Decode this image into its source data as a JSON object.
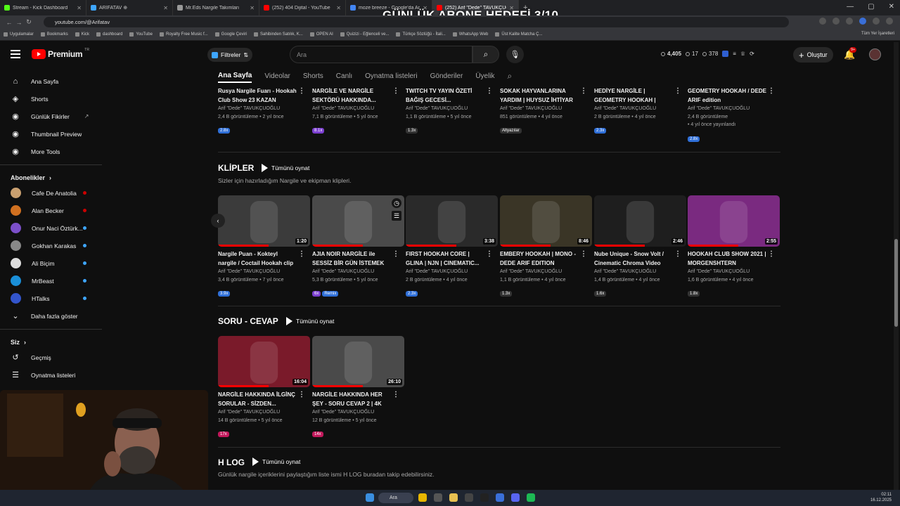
{
  "browser": {
    "tabs": [
      {
        "label": "Stream - Kick Dashboard",
        "color": "#53fc18"
      },
      {
        "label": "ARİFATAV ⊕",
        "color": "#3ea6ff"
      },
      {
        "label": "Mr.Eds Nargile Takımları",
        "color": "#999999"
      },
      {
        "label": "(252) 404 Dijital - YouTube",
        "color": "#ff0000"
      },
      {
        "label": "moze breeze - Google'da Ara",
        "color": "#4285f4"
      },
      {
        "label": "(252) Arif \"Dede\" TAVUKÇUOĞ",
        "color": "#ff0000"
      }
    ],
    "url": "youtube.com/@Arifatav",
    "bookmarks": [
      "Uygulamalar",
      "Bookmarks",
      "Kick",
      "dashboard",
      "YouTube",
      "Royalty Free Music f...",
      "Google Çeviri",
      "Sahibinden Satılık, K...",
      "OPEN AI",
      "Quizizi - Eğlenceli ve...",
      "Türkçe Sözlüğü - İtali...",
      "WhatsApp Web",
      "Üst Kalite Matcha Ç..."
    ],
    "all_bookmarks": "Tüm Yer İşaretleri"
  },
  "overlay_title": "GÜNLÜK ABONE HEDEFİ 3/10",
  "header": {
    "logo_text": "Premium",
    "logo_sup": "TR",
    "filters_label": "Filtreler",
    "search_placeholder": "Ara",
    "stats": [
      "4,405",
      "17",
      "378"
    ],
    "create_label": "Oluştur",
    "notif_badge": "9+"
  },
  "sidebar": {
    "nav": [
      {
        "label": "Ana Sayfa",
        "icon": "home-icon"
      },
      {
        "label": "Shorts",
        "icon": "shorts-icon"
      },
      {
        "label": "Günlük Fikirler",
        "icon": "bulb-icon"
      },
      {
        "label": "Thumbnail Preview",
        "icon": "image-icon"
      },
      {
        "label": "More Tools",
        "icon": "tools-icon"
      }
    ],
    "subs_title": "Abonelikler",
    "subs": [
      {
        "label": "Cafe De Anatolia",
        "color": "#c9a070",
        "live": "#cc0000"
      },
      {
        "label": "Alan Becker",
        "color": "#d07020",
        "live": "#cc0000"
      },
      {
        "label": "Onur Naci Öztürk...",
        "color": "#7b4fc9",
        "live": "#3ea6ff"
      },
      {
        "label": "Gokhan Karakas",
        "color": "#888888",
        "live": "#3ea6ff"
      },
      {
        "label": "Ali Biçim",
        "color": "#dddddd",
        "live": "#3ea6ff"
      },
      {
        "label": "MrBeast",
        "color": "#1a8fd8",
        "live": "#3ea6ff"
      },
      {
        "label": "HTalks",
        "color": "#3355cc",
        "live": "#3ea6ff"
      }
    ],
    "show_more": "Daha fazla göster",
    "you_title": "Siz",
    "you": [
      {
        "label": "Geçmiş",
        "icon": "history-icon"
      },
      {
        "label": "Oynatma listeleri",
        "icon": "playlist-icon"
      }
    ]
  },
  "channel_tabs": [
    "Ana Sayfa",
    "Videolar",
    "Shorts",
    "Canlı",
    "Oynatma listeleri",
    "Gönderiler",
    "Üyelik"
  ],
  "top_row": [
    {
      "title": "Rusya Nargile Fuarı - Hookah Club Show 23 KAZAN",
      "author": "Arif \"Dede\" TAVUKÇUOĞLU",
      "views": "2,4 B görüntüleme • 2 yıl önce",
      "chip": "2.8x",
      "chip_color": "#2f6fd8"
    },
    {
      "title": "NARGİLE VE NARGİLE SEKTÖRÜ HAKKINDA...",
      "author": "Arif \"Dede\" TAVUKÇUOĞLU",
      "views": "7,1 B görüntüleme • 5 yıl önce",
      "chip": "8.1x",
      "chip_color": "#7b3fd0"
    },
    {
      "title": "TWITCH TV YAYIN ÖZETİ BAĞIŞ GECESİ...",
      "author": "Arif \"Dede\" TAVUKÇUOĞLU",
      "views": "1,1 B görüntüleme • 5 yıl önce",
      "chip": "1.3x",
      "chip_color": "#333333"
    },
    {
      "title": "SOKAK HAYVANLARINA YARDIM | HUYSUZ İHTİYAR ...",
      "author": "Arif \"Dede\" TAVUKÇUOĞLU",
      "views": "851 görüntüleme • 4 yıl önce",
      "chip": "Altyazılar",
      "chip_color": "#333333"
    },
    {
      "title": "HEDİYE NARGİLE | GEOMETRY HOOKAH | DED...",
      "author": "Arif \"Dede\" TAVUKÇUOĞLU",
      "views": "2 B görüntüleme • 4 yıl önce",
      "chip": "2.3x",
      "chip_color": "#2f6fd8"
    },
    {
      "title": "GEOMETRY HOOKAH / DEDE ARIF edition",
      "author": "Arif \"Dede\" TAVUKÇUOĞLU",
      "views": "2,4 B görüntüleme",
      "views2": "• 4 yıl önce yayınlandı",
      "chip": "2.8x",
      "chip_color": "#2f6fd8"
    }
  ],
  "klipler": {
    "title": "KLİPLER",
    "play_all": "Tümünü oynat",
    "desc": "Sizler için hazırladığım Nargile ve ekipman klipleri.",
    "videos": [
      {
        "title": "Nargile Puan - Kokteyl nargile / Coctail Hookah clip",
        "author": "Arif \"Dede\" TAVUKÇUOĞLU",
        "views": "3,4 B görüntüleme • 7 yıl önce",
        "chip": "3.9x",
        "chip_color": "#2f6fd8",
        "dur": "1:20",
        "bg": "#3b3b3b"
      },
      {
        "title": "AJIA NOIR NARGİLE ile SESSİZ BİR GÜN İSTEMEK",
        "author": "Arif \"Dede\" TAVUKÇUOĞLU",
        "views": "5,3 B görüntüleme • 5 yıl önce",
        "chip": "6x",
        "chip_color": "#7b3fd0",
        "chip2": "Remix",
        "dur": "",
        "bg": "#4a4a4a"
      },
      {
        "title": "FIRST HOOKAH CORE | GLINA | NJN | CINEMATIC...",
        "author": "Arif \"Dede\" TAVUKÇUOĞLU",
        "views": "2 B görüntüleme • 4 yıl önce",
        "chip": "2.3x",
        "chip_color": "#2f6fd8",
        "dur": "3:38",
        "bg": "#2a2a2a"
      },
      {
        "title": "EMBERY HOOKAH | MONO - DEDE ARIF EDITION",
        "author": "Arif \"Dede\" TAVUKÇUOĞLU",
        "views": "1,1 B görüntüleme • 4 yıl önce",
        "chip": "1.3x",
        "chip_color": "#333333",
        "dur": "8:46",
        "bg": "#3a3526"
      },
      {
        "title": "Nube Unique - Snow Volt / Cinematic Chroma Video",
        "author": "Arif \"Dede\" TAVUKÇUOĞLU",
        "views": "1,4 B görüntüleme • 4 yıl önce",
        "chip": "1.6x",
        "chip_color": "#333333",
        "dur": "2:46",
        "bg": "#1e1e1e"
      },
      {
        "title": "HOOKAH CLUB SHOW 2021 | MORGENSHTERN CONCER...",
        "author": "Arif \"Dede\" TAVUKÇUOĞLU",
        "views": "1,6 B görüntüleme • 4 yıl önce",
        "chip": "1.8x",
        "chip_color": "#333333",
        "dur": "2:55",
        "bg": "#7a2a80"
      }
    ]
  },
  "soru": {
    "title": "SORU - CEVAP",
    "play_all": "Tümünü oynat",
    "videos": [
      {
        "title": "NARGİLE HAKKINDA İLGİNÇ SORULAR - SİZDEN...",
        "author": "Arif \"Dede\" TAVUKÇUOĞLU",
        "views": "14 B görüntüleme • 5 yıl önce",
        "chip": "17x",
        "chip_color": "#c2185b",
        "dur": "16:04",
        "bg": "#7a1a2a"
      },
      {
        "title": "NARGİLE HAKKINDA HER ŞEY - SORU CEVAP 2 | 4K",
        "author": "Arif \"Dede\" TAVUKÇUOĞLU",
        "views": "12 B görüntüleme • 5 yıl önce",
        "chip": "14x",
        "chip_color": "#c2185b",
        "dur": "26:10",
        "bg": "#4a4a4a"
      }
    ]
  },
  "hlog": {
    "title": "H LOG",
    "play_all": "Tümünü oynat",
    "desc": "Günlük nargile içeriklerini paylaştığım liste ismi H LOG buradan takip edebilirsiniz."
  },
  "taskbar": {
    "search": "Ara",
    "time": "02:11",
    "date": "16.12.2025"
  }
}
